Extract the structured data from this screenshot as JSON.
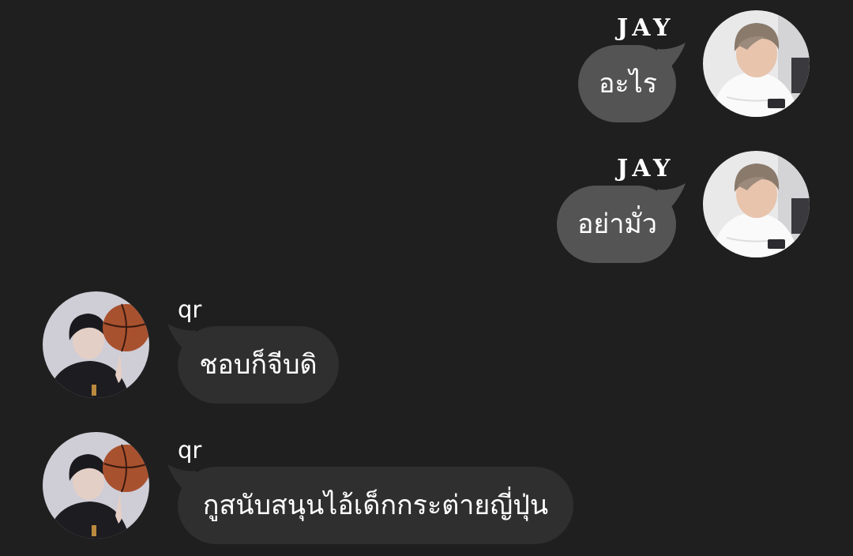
{
  "conversation": {
    "messages": [
      {
        "direction": "outgoing",
        "sender": "JAY",
        "text": "อะไร",
        "avatar_icon": "jay-avatar"
      },
      {
        "direction": "outgoing",
        "sender": "JAY",
        "text": "อย่ามั่ว",
        "avatar_icon": "jay-avatar"
      },
      {
        "direction": "incoming",
        "sender": "qr",
        "text": "ชอบก็จีบดิ",
        "avatar_icon": "qr-basketball-avatar"
      },
      {
        "direction": "incoming",
        "sender": "qr",
        "text": "กูสนับสนุนไอ้เด็กกระต่ายญี่ปุ่น",
        "avatar_icon": "qr-basketball-avatar"
      }
    ]
  },
  "colors": {
    "background": "#1f1f1f",
    "outgoing_bubble": "#545454",
    "incoming_bubble": "#2f2f2f",
    "text": "#ffffff"
  }
}
